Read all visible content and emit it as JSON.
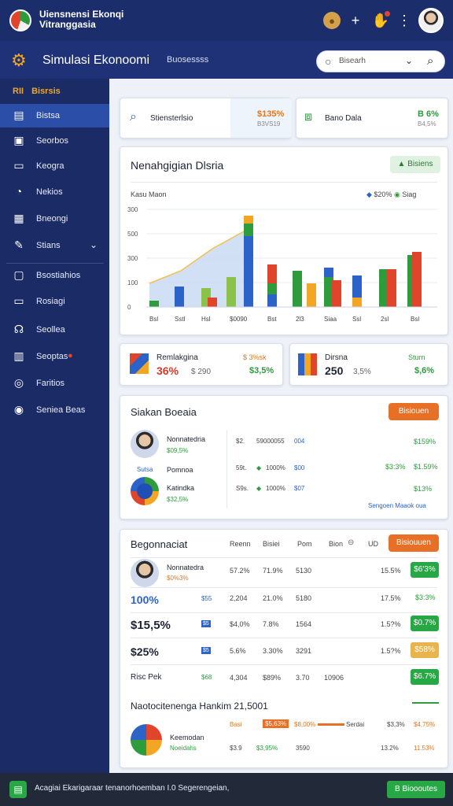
{
  "topbar": {
    "title_line1": "Uiensnensi Ekonqi",
    "title_line2": "Vitranggasia"
  },
  "header": {
    "title": "Simulasi Ekonoomi",
    "subtitle": "Buosessss"
  },
  "search": {
    "placeholder": "Bisearh",
    "caret": "⌄"
  },
  "sidebar": {
    "heading_badge": "RII",
    "heading": "Bisrsis",
    "items": [
      {
        "label": "Bistsa",
        "icon": "chart-bar-icon"
      },
      {
        "label": "Seorbos",
        "icon": "save-icon"
      },
      {
        "label": "Keogra",
        "icon": "tv-icon"
      },
      {
        "label": "Nekios",
        "icon": "clock-icon"
      },
      {
        "label": "Bneongi",
        "icon": "grid-icon"
      },
      {
        "label": "Stians",
        "icon": "edit-icon"
      },
      {
        "label": "Bsostiahios",
        "icon": "monitor-icon"
      },
      {
        "label": "Rosiagi",
        "icon": "inbox-icon"
      },
      {
        "label": "Seollea",
        "icon": "headset-icon"
      },
      {
        "label": "Seoptas",
        "icon": "gift-icon"
      },
      {
        "label": "Faritios",
        "icon": "target-icon"
      },
      {
        "label": "Seniea Beas",
        "icon": "globe-icon"
      }
    ]
  },
  "stats_top": [
    {
      "label": "Stiensterlsio",
      "value": "$135%",
      "sub": "B3VS19"
    },
    {
      "label": "Bano Dala",
      "value": "B 6%",
      "sub": "B4,5%"
    }
  ],
  "chart_card": {
    "title": "Nenahgigian Dlsria",
    "button": "Bisiens",
    "legend_left": "Kasu Maon",
    "legend_a": "$20%",
    "legend_b": "Siag"
  },
  "chart_data": {
    "type": "bar",
    "y_ticks": [
      "300",
      "500",
      "300",
      "100",
      "0"
    ],
    "categories": [
      "Bsl",
      "Sstl",
      "Hsl",
      "$0090",
      "Bst",
      "2l3",
      "Siaa",
      "Ssl",
      "2sl",
      "Bsl"
    ],
    "series_colors": [
      "#2e9b3c",
      "#2b63c9",
      "#e0442a",
      "#f3a623",
      "#8bc34a"
    ]
  },
  "stats_mid": [
    {
      "label": "Remlakgina",
      "value": "36%",
      "value2": "$ 290",
      "right": "$ 3%sk",
      "right2": "$3,5%"
    },
    {
      "label": "Dirsna",
      "value": "250",
      "value2": "3,5%",
      "right": "Sturn",
      "right2": "$,6%"
    }
  ],
  "list_card": {
    "title": "Siakan Boeaia",
    "button": "Bisiouen",
    "rows": [
      {
        "name": "Nonnatedria",
        "sub": "$09,5%",
        "c1": "$2.",
        "c2": "59000055",
        "c3": "004",
        "right": "$159%"
      },
      {
        "name": "Pomnoa",
        "sub": "Sutsa",
        "c1": "59t.",
        "c2": "1000%",
        "c3": "$00",
        "right": "$3:3%",
        "right2": "$1.59%"
      },
      {
        "name": "Katindka",
        "sub": "$32,5%",
        "c1": "S9s.",
        "c2": "1000%",
        "c3": "$07",
        "right": "$13%"
      }
    ],
    "link": "Sengoen Maaok oua"
  },
  "table_card": {
    "title": "Begonnaciat",
    "headers": [
      "Reenn",
      "Bisiei",
      "Pom",
      "Bion",
      "UD"
    ],
    "button": "Bisiouuen",
    "rows": [
      {
        "name": "Nonnatedra",
        "sub": "$0%3%",
        "b": "",
        "c1": "57.2%",
        "c2": "71.9%",
        "c3": "5130",
        "c4": "15.5%",
        "badge": "$6'3%"
      },
      {
        "name": "100%",
        "sub": "",
        "b": "$55",
        "c1": "2,204",
        "c2": "21.0%",
        "c3": "5180",
        "c4": "17.5%",
        "badge": "$3:3%"
      },
      {
        "name": "$15,5%",
        "sub": "",
        "b": "$5",
        "c1": "$4,0%",
        "c2": "7.8%",
        "c3": "1564",
        "c4": "1.5?%",
        "badge": "$0.7%"
      },
      {
        "name": "$25%",
        "sub": "",
        "b": "$5",
        "c1": "5.6%",
        "c2": "3.30%",
        "c3": "3291",
        "c4": "1.5?%",
        "badge": "$58%"
      },
      {
        "name": "Risc Pek",
        "sub": "",
        "b": "$68",
        "c1": "4,304",
        "c2": "$89%",
        "c3": "3.70",
        "c4": "10906",
        "badge": "$6.7%"
      }
    ],
    "bottom_title": "Naotocitenenga Hankim 21,5001",
    "bottom_row1": {
      "a": "Basi",
      "b": "$5,63%",
      "c": "$8,00%",
      "d": "Serdai",
      "e": "$3,3%",
      "f": "$4,75%"
    },
    "bottom_name": "Keemodan",
    "bottom_sub": "Noeidahs",
    "bottom_row2": {
      "a": "$3.9",
      "b": "$3,95%",
      "c": "3590",
      "e": "13.2%",
      "f": "11.53%"
    }
  },
  "footer": {
    "text": "Acagiai Ekarigaraar tenanorhoemban I.0 Segerengeian,",
    "button": "B Bioooutes"
  }
}
